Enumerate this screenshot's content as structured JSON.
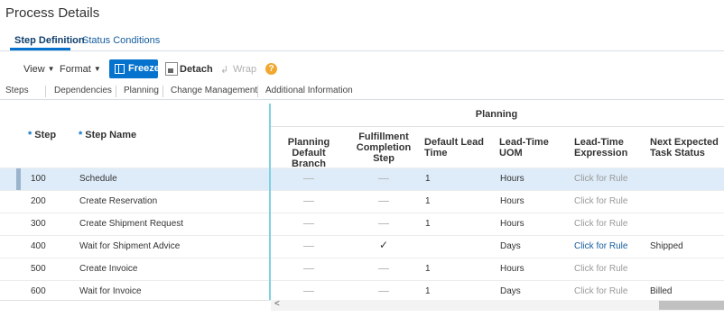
{
  "page": {
    "title": "Process Details"
  },
  "tabs": [
    "Step Definition",
    "Status Conditions"
  ],
  "toolbar": {
    "view": "View",
    "format": "Format",
    "freeze": "Freeze",
    "detach": "Detach",
    "wrap": "Wrap",
    "help_glyph": "?",
    "wrap_glyph": "↲",
    "caret_glyph": "▼"
  },
  "column_groups": [
    "Steps",
    "Dependencies",
    "Planning",
    "Change Management",
    "Additional Information"
  ],
  "table": {
    "group_header": "Planning",
    "required_marker": "*",
    "headers": {
      "step": "Step",
      "step_name": "Step Name",
      "planning_default_branch": [
        "Planning",
        "Default Branch"
      ],
      "fulfillment_completion_step": [
        "Fulfillment",
        "Completion",
        "Step"
      ],
      "default_lead_time": [
        "Default Lead",
        "Time"
      ],
      "lead_time_uom": [
        "Lead-Time",
        "UOM"
      ],
      "lead_time_expression": [
        "Lead-Time",
        "Expression"
      ],
      "next_expected_task_status": [
        "Next Expected",
        "Task Status"
      ]
    },
    "rows": [
      {
        "step": "100",
        "name": "Schedule",
        "branch": "dash",
        "completion": "dash",
        "lead_time": "1",
        "uom": "Hours",
        "expression": "Click for Rule",
        "expression_active": false,
        "next_status": ""
      },
      {
        "step": "200",
        "name": "Create Reservation",
        "branch": "dash",
        "completion": "dash",
        "lead_time": "1",
        "uom": "Hours",
        "expression": "Click for Rule",
        "expression_active": false,
        "next_status": ""
      },
      {
        "step": "300",
        "name": "Create Shipment Request",
        "branch": "dash",
        "completion": "dash",
        "lead_time": "1",
        "uom": "Hours",
        "expression": "Click for Rule",
        "expression_active": false,
        "next_status": ""
      },
      {
        "step": "400",
        "name": "Wait for Shipment Advice",
        "branch": "dash",
        "completion": "check",
        "lead_time": "",
        "uom": "Days",
        "expression": "Click for Rule",
        "expression_active": true,
        "next_status": "Shipped"
      },
      {
        "step": "500",
        "name": "Create Invoice",
        "branch": "dash",
        "completion": "dash",
        "lead_time": "1",
        "uom": "Hours",
        "expression": "Click for Rule",
        "expression_active": false,
        "next_status": ""
      },
      {
        "step": "600",
        "name": "Wait for Invoice",
        "branch": "dash",
        "completion": "dash",
        "lead_time": "1",
        "uom": "Days",
        "expression": "Click for Rule",
        "expression_active": false,
        "next_status": "Billed"
      }
    ],
    "selected_row_index": 0,
    "check_glyph": "✓",
    "scroll_left_glyph": "<"
  },
  "colors": {
    "accent": "#0572ce",
    "selected_row": "#deecf9",
    "frozen_divider": "#7fd0e0"
  }
}
